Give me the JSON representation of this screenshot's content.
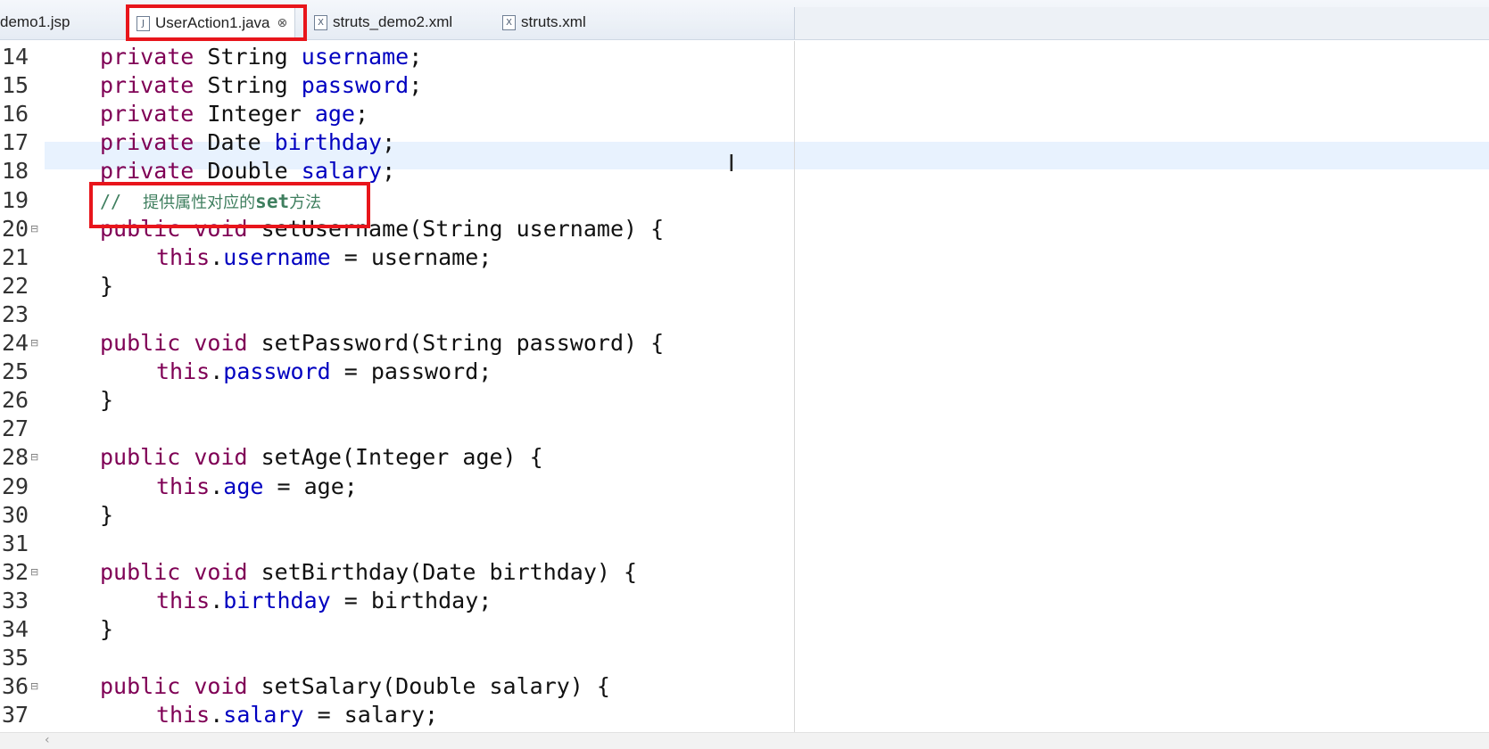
{
  "tabs": [
    {
      "label": "demo1.jsp",
      "icon": "jsp-file-icon"
    },
    {
      "label": "UserAction1.java",
      "icon": "java-file-icon",
      "active": true,
      "close": "⊗"
    },
    {
      "label": "struts_demo2.xml",
      "icon": "xml-file-icon"
    },
    {
      "label": "struts.xml",
      "icon": "xml-file-icon"
    }
  ],
  "editor": {
    "lines": [
      {
        "n": "14",
        "parts": [
          [
            "kw",
            "private"
          ],
          [
            "tx",
            " String "
          ],
          [
            "fd",
            "username"
          ],
          [
            "tx",
            ";"
          ]
        ]
      },
      {
        "n": "15",
        "parts": [
          [
            "kw",
            "private"
          ],
          [
            "tx",
            " String "
          ],
          [
            "fd",
            "password"
          ],
          [
            "tx",
            ";"
          ]
        ]
      },
      {
        "n": "16",
        "parts": [
          [
            "kw",
            "private"
          ],
          [
            "tx",
            " Integer "
          ],
          [
            "fd",
            "age"
          ],
          [
            "tx",
            ";"
          ]
        ]
      },
      {
        "n": "17",
        "parts": [
          [
            "kw",
            "private"
          ],
          [
            "tx",
            " Date "
          ],
          [
            "fd",
            "birthday"
          ],
          [
            "tx",
            ";"
          ]
        ]
      },
      {
        "n": "18",
        "parts": [
          [
            "kw",
            "private"
          ],
          [
            "tx",
            " Double "
          ],
          [
            "fd",
            "salary"
          ],
          [
            "tx",
            ";"
          ]
        ]
      },
      {
        "n": "19",
        "comment": {
          "prefix": "//  ",
          "text1": "提供属性对应的",
          "bold": "set",
          "text2": "方法"
        }
      },
      {
        "n": "20",
        "fold": true,
        "parts": [
          [
            "kw",
            "public void"
          ],
          [
            "tx",
            " setUsername(String username) {"
          ]
        ]
      },
      {
        "n": "21",
        "indent": true,
        "parts": [
          [
            "kw",
            "this"
          ],
          [
            "tx",
            "."
          ],
          [
            "fd",
            "username"
          ],
          [
            "tx",
            " = username;"
          ]
        ]
      },
      {
        "n": "22",
        "parts": [
          [
            "tx",
            "}"
          ]
        ]
      },
      {
        "n": "23",
        "parts": []
      },
      {
        "n": "24",
        "fold": true,
        "parts": [
          [
            "kw",
            "public void"
          ],
          [
            "tx",
            " setPassword(String password) {"
          ]
        ]
      },
      {
        "n": "25",
        "indent": true,
        "parts": [
          [
            "kw",
            "this"
          ],
          [
            "tx",
            "."
          ],
          [
            "fd",
            "password"
          ],
          [
            "tx",
            " = password;"
          ]
        ]
      },
      {
        "n": "26",
        "parts": [
          [
            "tx",
            "}"
          ]
        ]
      },
      {
        "n": "27",
        "parts": []
      },
      {
        "n": "28",
        "fold": true,
        "parts": [
          [
            "kw",
            "public void"
          ],
          [
            "tx",
            " setAge(Integer age) {"
          ]
        ]
      },
      {
        "n": "29",
        "indent": true,
        "parts": [
          [
            "kw",
            "this"
          ],
          [
            "tx",
            "."
          ],
          [
            "fd",
            "age"
          ],
          [
            "tx",
            " = age;"
          ]
        ]
      },
      {
        "n": "30",
        "parts": [
          [
            "tx",
            "}"
          ]
        ]
      },
      {
        "n": "31",
        "parts": []
      },
      {
        "n": "32",
        "fold": true,
        "parts": [
          [
            "kw",
            "public void"
          ],
          [
            "tx",
            " setBirthday(Date birthday) {"
          ]
        ]
      },
      {
        "n": "33",
        "indent": true,
        "parts": [
          [
            "kw",
            "this"
          ],
          [
            "tx",
            "."
          ],
          [
            "fd",
            "birthday"
          ],
          [
            "tx",
            " = birthday;"
          ]
        ]
      },
      {
        "n": "34",
        "parts": [
          [
            "tx",
            "}"
          ]
        ]
      },
      {
        "n": "35",
        "parts": []
      },
      {
        "n": "36",
        "fold": true,
        "parts": [
          [
            "kw",
            "public void"
          ],
          [
            "tx",
            " setSalary(Double salary) {"
          ]
        ]
      },
      {
        "n": "37",
        "indent": true,
        "parts": [
          [
            "kw",
            "this"
          ],
          [
            "tx",
            "."
          ],
          [
            "fd",
            "salary"
          ],
          [
            "tx",
            " = salary;"
          ]
        ]
      }
    ]
  },
  "colors": {
    "keyword": "#7f0055",
    "field": "#0000c0",
    "comment": "#3f7f5f",
    "highlight": "#e8151b"
  }
}
